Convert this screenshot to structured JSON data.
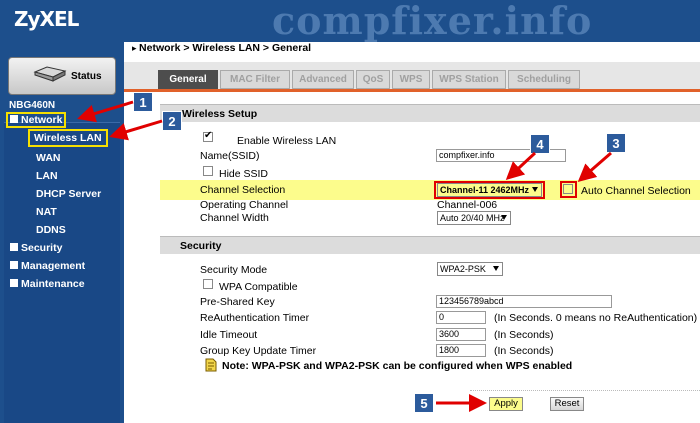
{
  "brand": {
    "logo": "ZyXEL",
    "watermark": "compfixer.info"
  },
  "status_label": "Status",
  "model": "NBG460N",
  "nav": [
    {
      "label": "Network",
      "id": "network"
    },
    {
      "label": "Wireless LAN",
      "id": "wireless-lan"
    },
    {
      "label": "WAN",
      "id": "wan"
    },
    {
      "label": "LAN",
      "id": "lan"
    },
    {
      "label": "DHCP Server",
      "id": "dhcp-server"
    },
    {
      "label": "NAT",
      "id": "nat"
    },
    {
      "label": "DDNS",
      "id": "ddns"
    },
    {
      "label": "Security",
      "id": "security"
    },
    {
      "label": "Management",
      "id": "management"
    },
    {
      "label": "Maintenance",
      "id": "maintenance"
    }
  ],
  "breadcrumb": "Network > Wireless LAN > General",
  "tabs": [
    "General",
    "MAC Filter",
    "Advanced",
    "QoS",
    "WPS",
    "WPS Station",
    "Scheduling"
  ],
  "wireless_setup": {
    "heading": "Wireless Setup",
    "enable_label": "Enable Wireless LAN",
    "ssid_label": "Name(SSID)",
    "ssid_value": "compfixer.info",
    "hide_ssid_label": "Hide SSID",
    "channel_selection_label": "Channel Selection",
    "channel_value": "Channel-11 2462MHz",
    "auto_channel_label": "Auto Channel Selection",
    "operating_channel_label": "Operating Channel",
    "operating_channel_value": "Channel-006",
    "channel_width_label": "Channel Width",
    "channel_width_value": "Auto 20/40 MHz"
  },
  "security": {
    "heading": "Security",
    "mode_label": "Security Mode",
    "mode_value": "WPA2-PSK",
    "wpa_compat_label": "WPA Compatible",
    "psk_label": "Pre-Shared Key",
    "psk_value": "123456789abcd",
    "reauth_label": "ReAuthentication Timer",
    "reauth_value": "0",
    "reauth_hint": "(In Seconds. 0 means no ReAuthentication)",
    "idle_label": "Idle Timeout",
    "idle_value": "3600",
    "idle_hint": "(In Seconds)",
    "gk_label": "Group Key Update Timer",
    "gk_value": "1800",
    "gk_hint": "(In Seconds)",
    "note": "Note: WPA-PSK and WPA2-PSK can be configured when WPS enabled"
  },
  "buttons": {
    "apply": "Apply",
    "reset": "Reset"
  },
  "callouts": [
    "1",
    "2",
    "3",
    "4",
    "5"
  ],
  "colors": {
    "highlight": "#fcfc8c",
    "accent": "#e1612a",
    "callout": "#2c5b9c",
    "arrow": "#e00000"
  }
}
